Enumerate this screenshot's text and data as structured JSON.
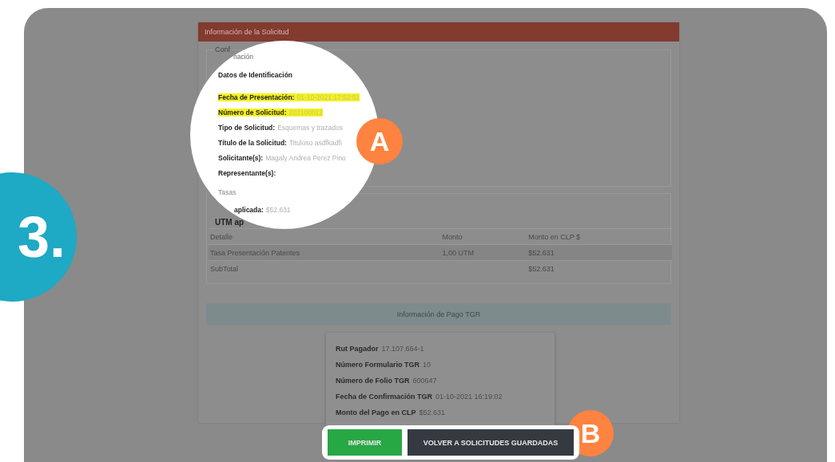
{
  "step_badge": {
    "label": "3."
  },
  "page": {
    "header": {
      "title": "Información de la Solicitud"
    },
    "section_legend": "Conf",
    "utm_label": "UTM ap",
    "table": {
      "columns": [
        "Detalle",
        "Monto",
        "Monto en CLP $"
      ],
      "rows": [
        {
          "cells": [
            "Tasa Presentación Patentes",
            "1,00 UTM",
            "$52.631"
          ],
          "shaded": true
        },
        {
          "cells": [
            "SubTotal",
            "",
            "$52.631"
          ],
          "shaded": false
        }
      ]
    },
    "payment": {
      "title": "Información de Pago TGR",
      "fields": [
        {
          "label": "Rut Pagador",
          "value": "17.107.664-1"
        },
        {
          "label": "Número Formulario TGR",
          "value": "10"
        },
        {
          "label": "Número de Folio TGR",
          "value": "600647"
        },
        {
          "label": "Fecha de Confirmación TGR",
          "value": "01-10-2021 16:19:02"
        },
        {
          "label": "Monto del Pago en CLP",
          "value": "$52.631"
        }
      ]
    }
  },
  "magnifier": {
    "section_legend": "nación",
    "subtitle": "Datos de Identificación",
    "fields": [
      {
        "label": "Fecha de Presentación:",
        "value": "01-10-2021 17:52:51",
        "highlighted": true
      },
      {
        "label": "Número de Solicitud:",
        "value": "202100012",
        "highlighted": true
      },
      {
        "label": "Tipo de Solicitud:",
        "value": "Esquemas y trazados",
        "highlighted": false
      },
      {
        "label": "Título de la Solicitud:",
        "value": "Tituloso asdfkadfi",
        "highlighted": false
      },
      {
        "label": "Solicitante(s):",
        "value": "Magaly Andrea Perez Pino",
        "highlighted": false
      },
      {
        "label": "Representante(s):",
        "highlighted": false
      }
    ],
    "tasas_legend": "Tasas",
    "utm_label": "aplicada:",
    "utm_value": "$52.631"
  },
  "callouts": [
    {
      "label": "A"
    },
    {
      "label": "B"
    }
  ],
  "buttons": [
    {
      "label": "IMPRIMIR",
      "kind": "primary"
    },
    {
      "label": "VOLVER A SOLICITUDES GUARDADAS",
      "kind": "dark"
    }
  ]
}
